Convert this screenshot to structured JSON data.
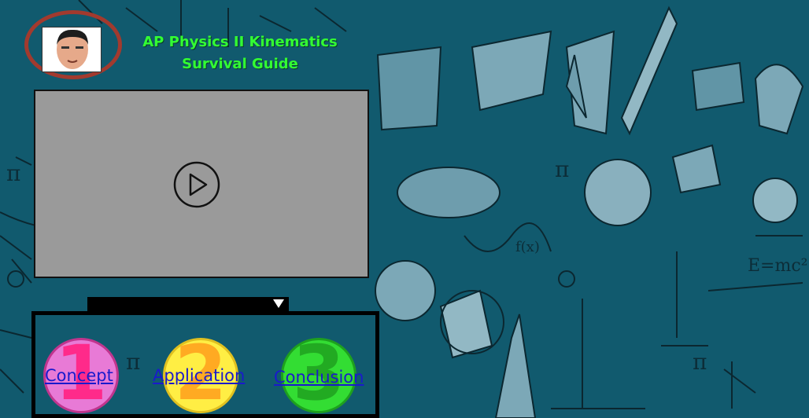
{
  "header": {
    "title_line1": "AP Physics II Kinematics",
    "title_line2": "Survival Guide"
  },
  "nav": {
    "items": [
      {
        "digit": "1",
        "label": "Concept"
      },
      {
        "digit": "2",
        "label": "Application"
      },
      {
        "digit": "3",
        "label": "Conclusion"
      }
    ]
  },
  "colors": {
    "background": "#115a6e",
    "title": "#33ff33",
    "ring": "#a23a2e",
    "concept_circle": "#e87ad6",
    "concept_digit": "#ff2a8a",
    "application_circle": "#ffee44",
    "application_digit": "#ffaa22",
    "conclusion_circle": "#33dd33",
    "conclusion_digit": "#22aa22"
  },
  "icons": {
    "play": "play-icon",
    "avatar": "avatar-photo",
    "dropdown": "chevron-down-icon"
  }
}
